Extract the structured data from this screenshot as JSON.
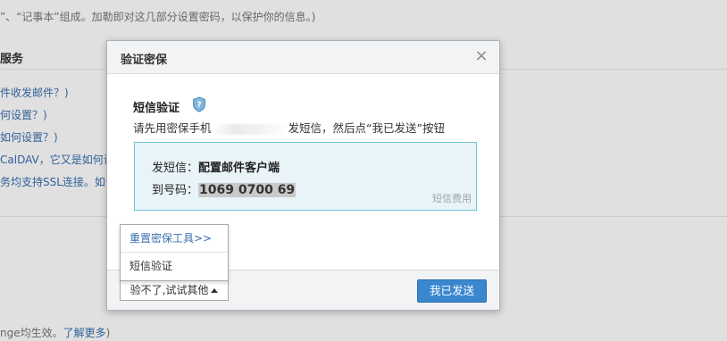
{
  "background": {
    "intro_text": "”、“记事本”组成。加勒即对这几部分设置密码，以保护你的信息。)",
    "section_heading": "服务",
    "lines": [
      "件收发邮件？)",
      "何设置？)",
      "如何设置？)",
      "CalDAV，它又是如何设",
      "务均支持SSL连接。如何"
    ],
    "bottom_text": "nge均生效。",
    "bottom_link": "了解更多",
    "bottom_suffix": ")"
  },
  "dialog": {
    "title": "验证密保",
    "close_glyph": "×",
    "section_title": "短信验证",
    "shield_icon": "shield-question-icon",
    "instruction_prefix": "请先用密保手机",
    "instruction_suffix": "发短信，然后点“我已发送”按钮",
    "sms_label": "发短信：",
    "sms_content": "配置邮件客户端",
    "to_label": "到号码：",
    "to_number": "1069 0700 69",
    "fee_note": "短信费用",
    "alt_button": "验不了,试试其他",
    "confirm_button": "我已发送"
  },
  "dropdown": {
    "items": [
      "重置密保工具>>",
      "短信验证"
    ]
  },
  "colors": {
    "accent": "#3a87cf",
    "info_bg": "#e9f4f8",
    "info_border": "#6cc4d6"
  }
}
